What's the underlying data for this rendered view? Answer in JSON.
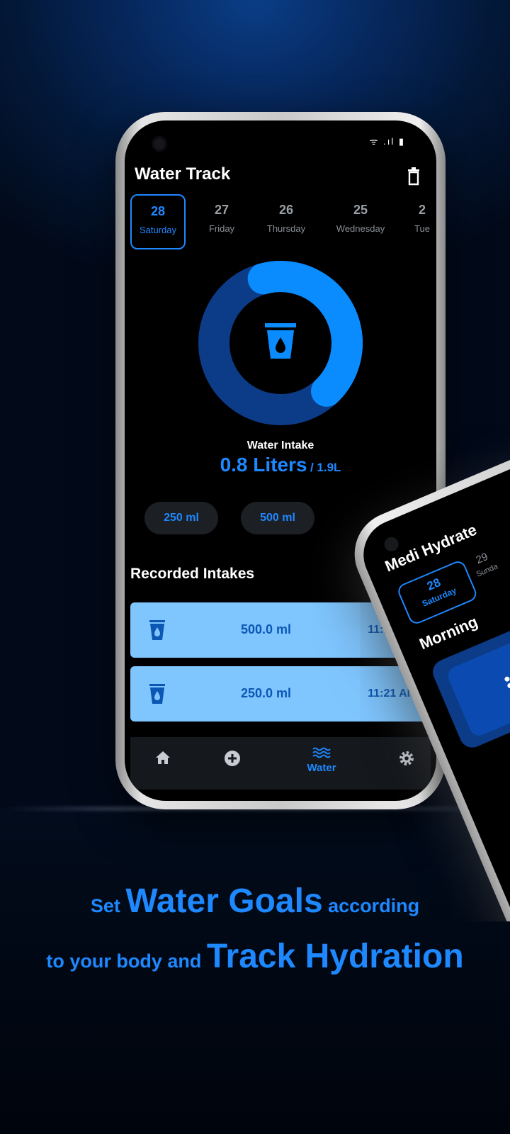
{
  "app": {
    "title": "Water Track",
    "status_icons": "ᯤ .ıl ▮"
  },
  "dates": [
    {
      "num": "28",
      "day": "Saturday",
      "active": true
    },
    {
      "num": "27",
      "day": "Friday",
      "active": false
    },
    {
      "num": "26",
      "day": "Thursday",
      "active": false
    },
    {
      "num": "25",
      "day": "Wednesday",
      "active": false
    },
    {
      "num": "2",
      "day": "Tue",
      "active": false
    }
  ],
  "intake": {
    "label": "Water Intake",
    "value": "0.8 Liters",
    "goal": "/ 1.9L",
    "progress_fraction": 0.42
  },
  "quick_add": [
    "250 ml",
    "500 ml"
  ],
  "recorded": {
    "title": "Recorded Intakes",
    "items": [
      {
        "amount": "500.0 ml",
        "time": "11:21 AM"
      },
      {
        "amount": "250.0 ml",
        "time": "11:21 AM"
      }
    ]
  },
  "nav": {
    "items": [
      "home-icon",
      "add-icon",
      "water-icon",
      "settings-icon"
    ],
    "active_label": "Water"
  },
  "second_phone": {
    "title": "Medi Hydrate",
    "active_date": {
      "num": "28",
      "day": "Saturday"
    },
    "next_date": {
      "num": "29",
      "day": "Sunda"
    },
    "section": "Morning"
  },
  "caption": {
    "line1_a": "Set ",
    "line1_b": "Water Goals",
    "line1_c": " according",
    "line2_a": "to your body and ",
    "line2_b": "Track Hydration"
  },
  "colors": {
    "accent": "#1e88ff",
    "record_bg": "#7fc6ff",
    "record_text": "#0b57b3",
    "ring_track": "#0c3b87"
  }
}
